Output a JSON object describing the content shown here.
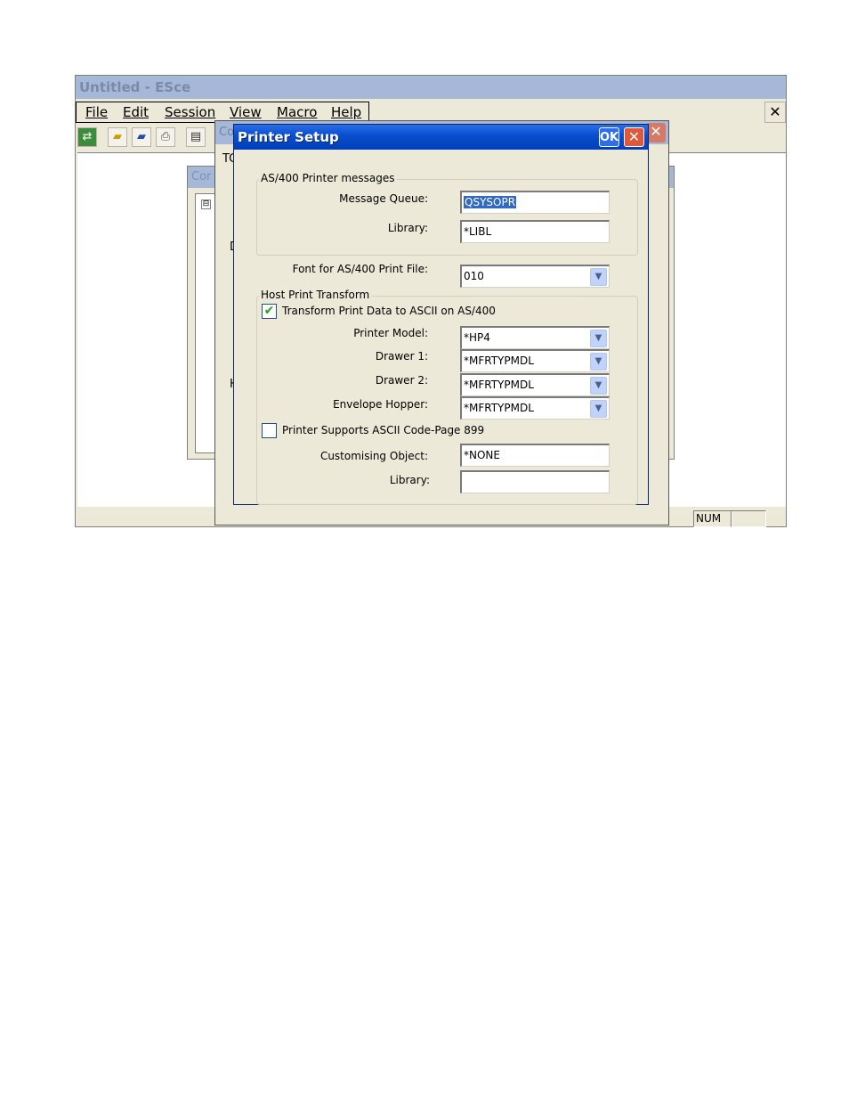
{
  "app": {
    "title": "Untitled - ESce",
    "menu": [
      "File",
      "Edit",
      "Session",
      "View",
      "Macro",
      "Help"
    ],
    "close_glyph": "✕",
    "toolbar_icons": [
      "connect-icon",
      "open-folder-icon",
      "open-folder-2-icon",
      "print-icon",
      "clipboard-icon"
    ],
    "status": {
      "num": "NUM"
    }
  },
  "background_windows": {
    "config_title_fragment": "Cor",
    "middle_title_fragment": "Co",
    "middle_fragments": [
      "TC",
      "D",
      "H"
    ],
    "tree_toggle": "⊟"
  },
  "dialog": {
    "title": "Printer Setup",
    "ok_label": "OK",
    "close_glyph": "✕",
    "as400_group": {
      "label": "AS/400 Printer messages",
      "message_queue_label": "Message Queue:",
      "message_queue_value": "QSYSOPR",
      "library_label": "Library:",
      "library_value": "*LIBL"
    },
    "font_label": "Font for AS/400 Print File:",
    "font_value": "010",
    "hpt_group": {
      "label": "Host Print Transform",
      "transform_checkbox_label": "Transform Print Data to ASCII on AS/400",
      "transform_checked": true,
      "printer_model_label": "Printer Model:",
      "printer_model_value": "*HP4",
      "drawer1_label": "Drawer 1:",
      "drawer1_value": "*MFRTYPMDL",
      "drawer2_label": "Drawer 2:",
      "drawer2_value": "*MFRTYPMDL",
      "envelope_label": "Envelope Hopper:",
      "envelope_value": "*MFRTYPMDL",
      "ascii899_checkbox_label": "Printer Supports ASCII Code-Page 899",
      "ascii899_checked": false,
      "customising_label": "Customising Object:",
      "customising_value": "*NONE",
      "library2_label": "Library:",
      "library2_value": ""
    }
  }
}
